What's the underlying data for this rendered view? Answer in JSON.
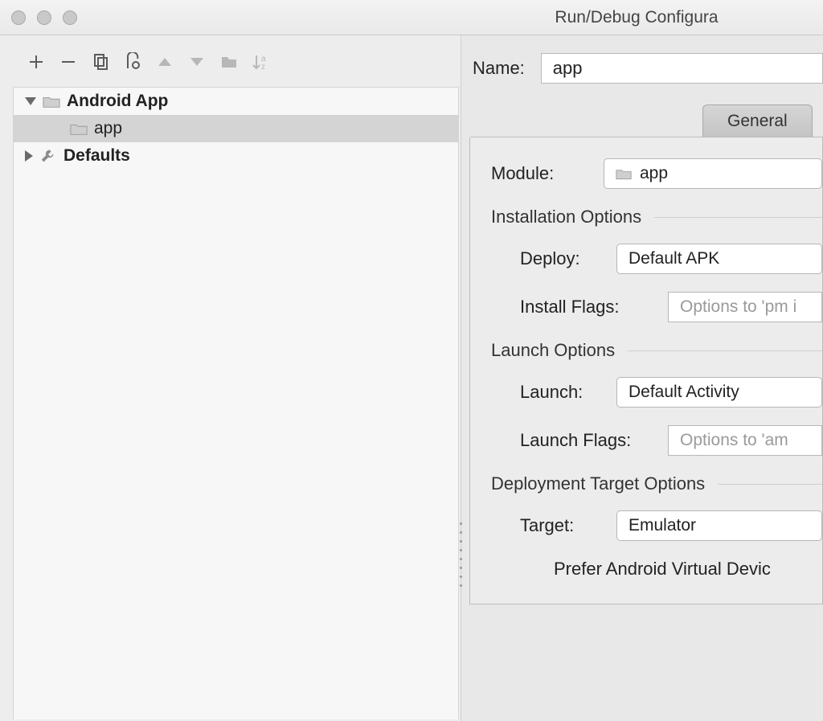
{
  "window": {
    "title": "Run/Debug Configura"
  },
  "tree": {
    "group1": {
      "label": "Android App",
      "expanded": true
    },
    "child1": {
      "label": "app"
    },
    "group2": {
      "label": "Defaults",
      "expanded": false
    }
  },
  "form": {
    "name_label": "Name:",
    "name_value": "app",
    "tabs": {
      "general": "General"
    },
    "module_label": "Module:",
    "module_value": "app",
    "install_section": "Installation Options",
    "deploy_label": "Deploy:",
    "deploy_value": "Default APK",
    "install_flags_label": "Install Flags:",
    "install_flags_placeholder": "Options to 'pm i",
    "launch_section": "Launch Options",
    "launch_label": "Launch:",
    "launch_value": "Default Activity",
    "launch_flags_label": "Launch Flags:",
    "launch_flags_placeholder": "Options to 'am",
    "deploy_target_section": "Deployment Target Options",
    "target_label": "Target:",
    "target_value": "Emulator",
    "prefer_label": "Prefer Android Virtual Devic"
  }
}
